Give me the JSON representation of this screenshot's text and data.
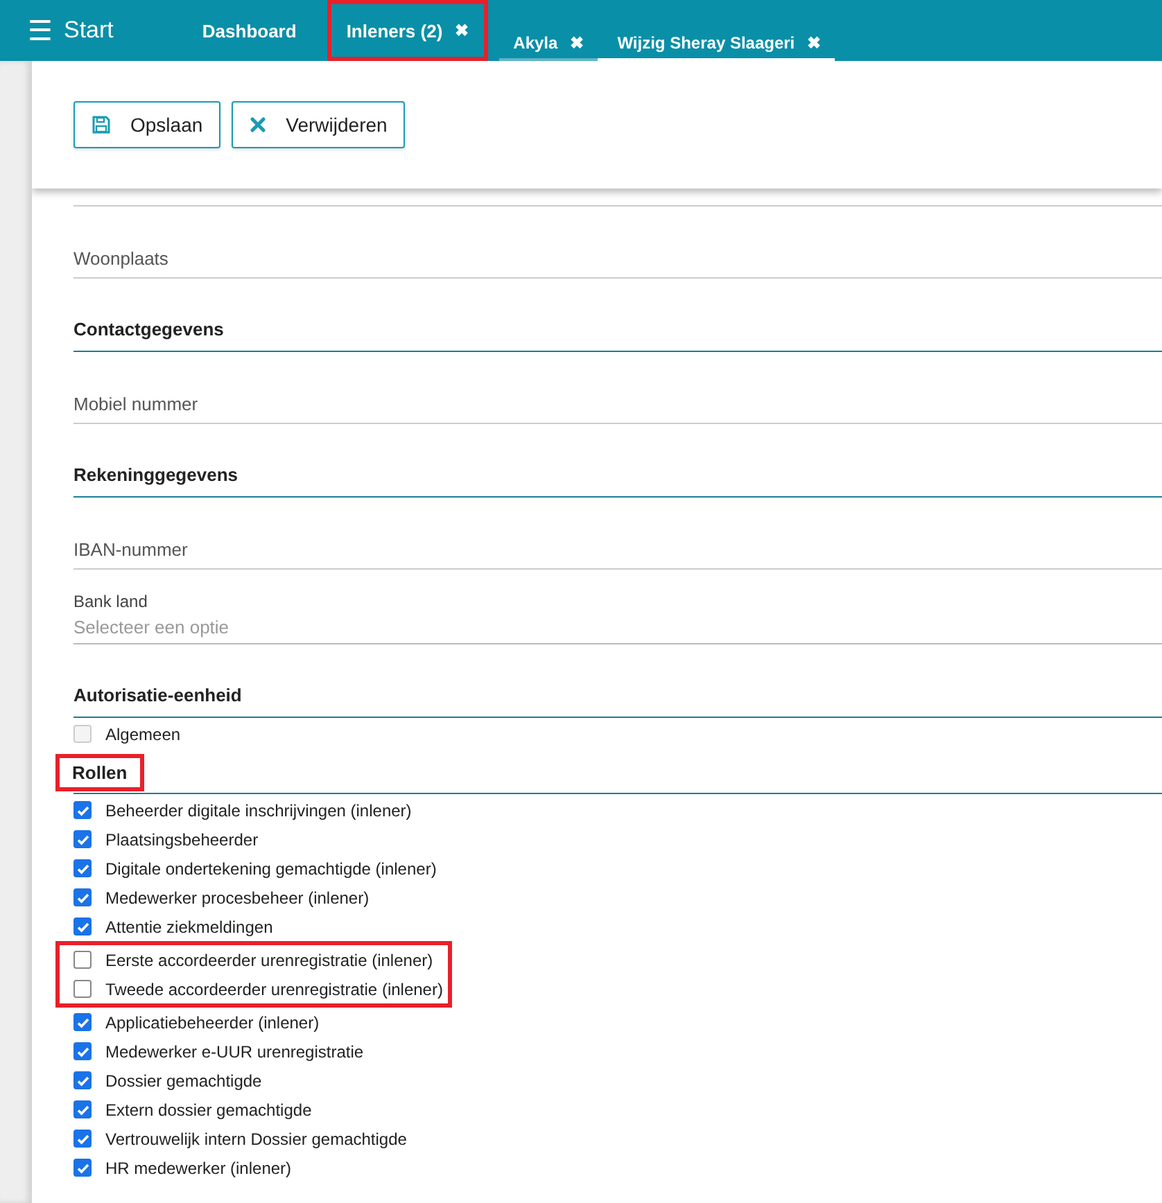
{
  "topbar": {
    "menu_icon": "☰",
    "title": "Start"
  },
  "tabs": [
    {
      "kind": "nav",
      "label": "Dashboard",
      "selected": false,
      "highlighted": false
    },
    {
      "kind": "nav",
      "label": "Inleners (2)",
      "close": "✖",
      "selected": false,
      "highlighted": true
    },
    {
      "kind": "tab",
      "label": "Akyla",
      "close": "✖",
      "selected": false,
      "highlighted": false
    },
    {
      "kind": "tab",
      "label": "Wijzig Sheray Slaageri",
      "close": "✖",
      "selected": true,
      "highlighted": false
    }
  ],
  "toolbar": [
    {
      "kind": "save",
      "label": "Opslaan"
    },
    {
      "kind": "delete",
      "label": "Verwijderen"
    }
  ],
  "form": [
    {
      "kind": "field",
      "label": "Woonplaats"
    },
    {
      "kind": "heading",
      "label": "Contactgegevens",
      "highlighted": false
    },
    {
      "kind": "field",
      "label": "Mobiel nummer"
    },
    {
      "kind": "heading",
      "label": "Rekeninggegevens",
      "highlighted": false
    },
    {
      "kind": "field",
      "label": "IBAN-nummer"
    },
    {
      "kind": "select",
      "label": "Bank land",
      "placeholder": "Selecteer een optie"
    },
    {
      "kind": "heading",
      "label": "Autorisatie-eenheid",
      "highlighted": false
    },
    {
      "kind": "checks",
      "items": [
        {
          "label": "Algemeen",
          "checked": false,
          "disabled": true,
          "highlighted": false
        }
      ]
    },
    {
      "kind": "heading",
      "label": "Rollen",
      "highlighted": true
    },
    {
      "kind": "checks",
      "items": [
        {
          "label": "Beheerder digitale inschrijvingen (inlener)",
          "checked": true,
          "disabled": false,
          "highlighted": false
        },
        {
          "label": "Plaatsingsbeheerder",
          "checked": true,
          "disabled": false,
          "highlighted": false
        },
        {
          "label": "Digitale ondertekening gemachtigde (inlener)",
          "checked": true,
          "disabled": false,
          "highlighted": false
        },
        {
          "label": "Medewerker procesbeheer (inlener)",
          "checked": true,
          "disabled": false,
          "highlighted": false
        },
        {
          "label": "Attentie ziekmeldingen",
          "checked": true,
          "disabled": false,
          "highlighted": false
        },
        {
          "label": "Eerste accordeerder urenregistratie (inlener)",
          "checked": false,
          "disabled": false,
          "highlighted": true
        },
        {
          "label": "Tweede accordeerder urenregistratie (inlener)",
          "checked": false,
          "disabled": false,
          "highlighted": true
        },
        {
          "label": "Applicatiebeheerder (inlener)",
          "checked": true,
          "disabled": false,
          "highlighted": false
        },
        {
          "label": "Medewerker e-UUR urenregistratie",
          "checked": true,
          "disabled": false,
          "highlighted": false
        },
        {
          "label": "Dossier gemachtigde",
          "checked": true,
          "disabled": false,
          "highlighted": false
        },
        {
          "label": "Extern dossier gemachtigde",
          "checked": true,
          "disabled": false,
          "highlighted": false
        },
        {
          "label": "Vertrouwelijk intern Dossier gemachtigde",
          "checked": true,
          "disabled": false,
          "highlighted": false
        },
        {
          "label": "HR medewerker (inlener)",
          "checked": true,
          "disabled": false,
          "highlighted": false
        }
      ]
    }
  ]
}
